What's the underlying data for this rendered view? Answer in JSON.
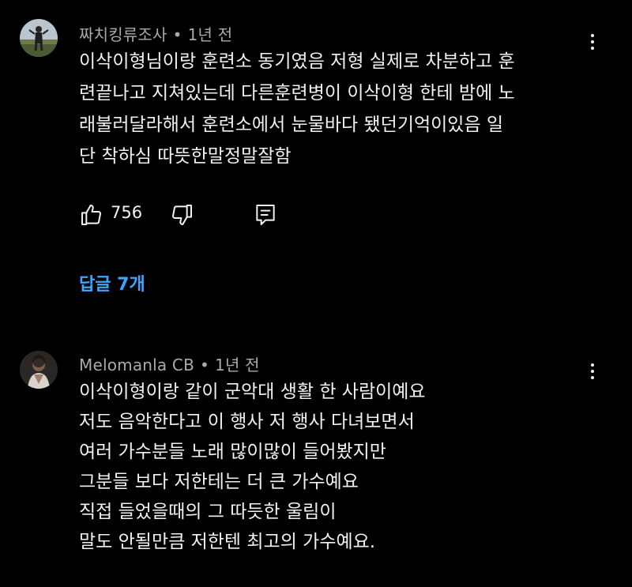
{
  "comments": [
    {
      "author": "짜치킹류조사",
      "time": "1년 전",
      "lines": [
        "이삭이형님이랑 훈련소 동기였음 저형 실제로 차분하고 훈",
        "련끝나고 지쳐있는데 다른훈련병이 이삭이형 한테 밤에 노",
        "래불러달라해서 훈련소에서 눈물바다 됐던기억이있음 일",
        "단 착하심 따뜻한말정말잘함"
      ],
      "likes": "756",
      "replies_label": "답글 7개"
    },
    {
      "author": "Melomanla CB",
      "time": "1년 전",
      "lines": [
        "이삭이형이랑 같이 군악대 생활 한 사람이예요",
        "저도 음악한다고 이 행사 저 행사 다녀보면서",
        "여러 가수분들 노래 많이많이 들어봤지만",
        "그분들 보다 저한테는 더 큰 가수예요",
        "직접 들었을때의 그 따듯한 울림이",
        "말도 안될만큼 저한텐 최고의 가수예요."
      ]
    }
  ],
  "colors": {
    "background": "#000000",
    "text": "#f1f1f1",
    "meta": "#aaaaaa",
    "link": "#3ea6ff"
  },
  "icons": {
    "like": "thumbs-up-icon",
    "dislike": "thumbs-down-icon",
    "reply": "comment-reply-icon",
    "more": "more-vert-icon"
  }
}
